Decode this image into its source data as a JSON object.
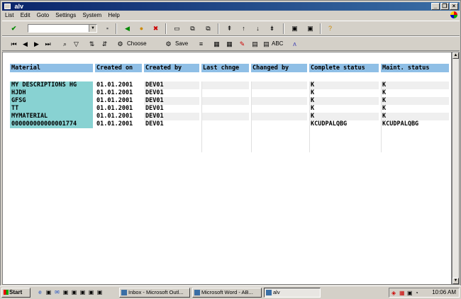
{
  "window": {
    "title": "alv"
  },
  "menu": [
    "List",
    "Edit",
    "Goto",
    "Settings",
    "System",
    "Help"
  ],
  "toolbar2": {
    "choose_label": "Choose",
    "save_label": "Save",
    "abc_label": "ABC"
  },
  "table": {
    "headers": [
      "Material",
      "Created on",
      "Created by",
      "Last chnge",
      "Changed by",
      "Complete status",
      "Maint. status"
    ],
    "rows": [
      [
        "MY DESCRIPTIONS HG",
        "01.01.2001",
        "DEV01",
        "",
        "",
        "K",
        "K"
      ],
      [
        "HJDH",
        "01.01.2001",
        "DEV01",
        "",
        "",
        "K",
        "K"
      ],
      [
        "GFSG",
        "01.01.2001",
        "DEV01",
        "",
        "",
        "K",
        "K"
      ],
      [
        "TT",
        "01.01.2001",
        "DEV01",
        "",
        "",
        "K",
        "K"
      ],
      [
        "MYMATERIAL",
        "01.01.2001",
        "DEV01",
        "",
        "",
        "K",
        "K"
      ],
      [
        "000000000000001774",
        "01.01.2001",
        "DEV01",
        "",
        "",
        "KCUDPALQBG",
        "KCUDPALQBG"
      ]
    ]
  },
  "taskbar": {
    "start_label": "Start",
    "tasks": [
      "Inbox - Microsoft Outl...",
      "Microsoft Word - AB...",
      "alv"
    ],
    "clock": "10:06 AM"
  }
}
